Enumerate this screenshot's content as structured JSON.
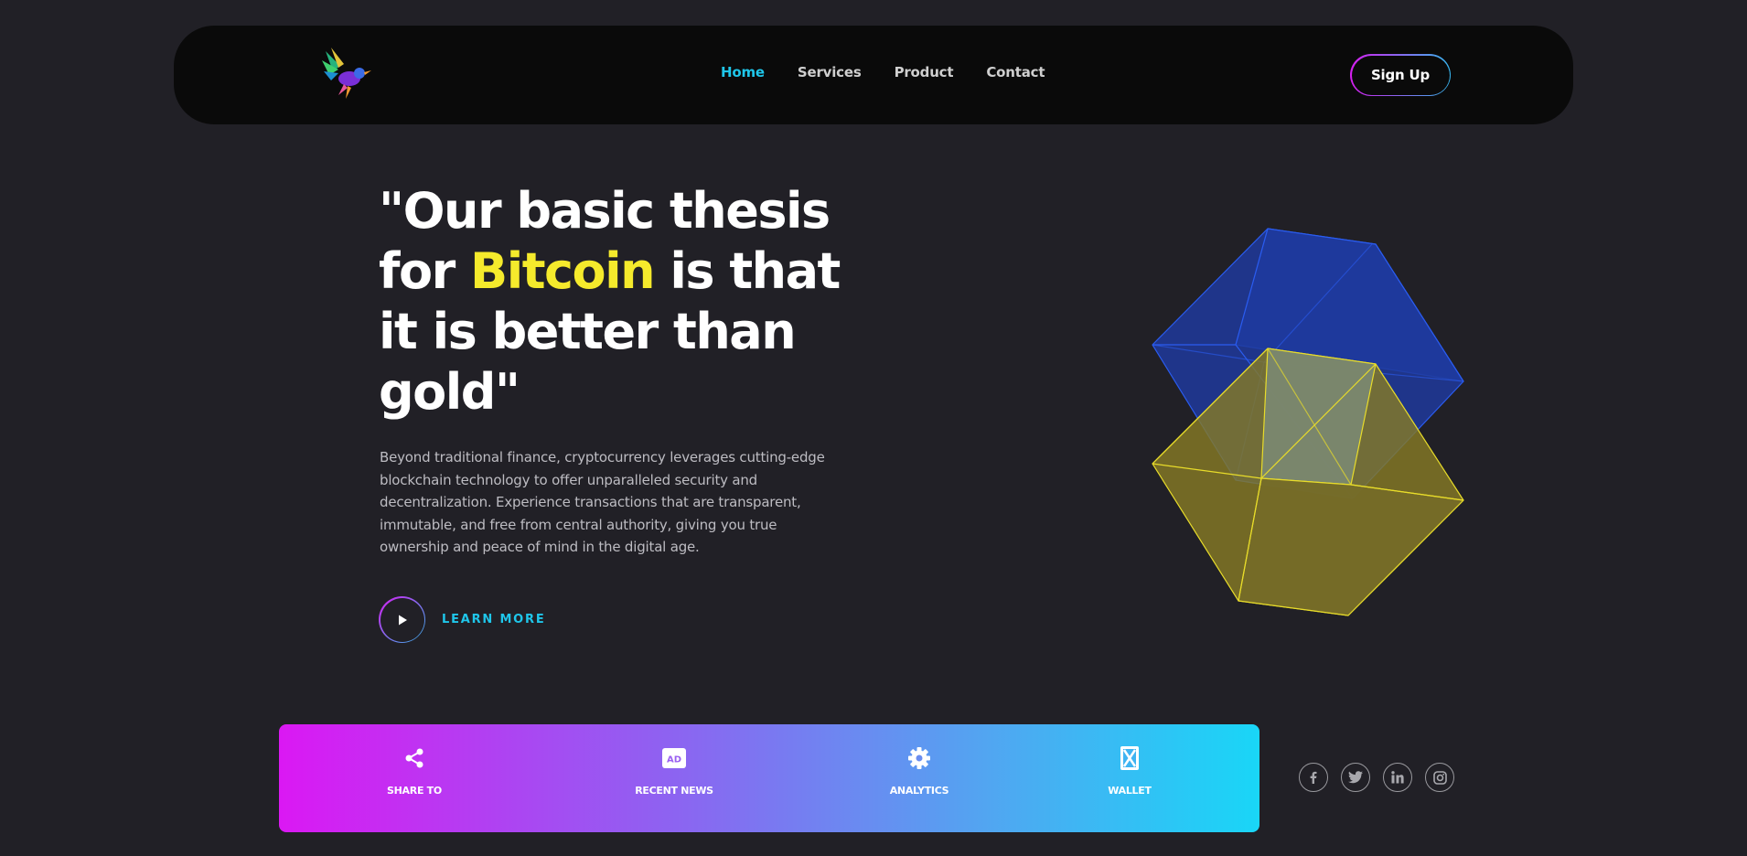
{
  "nav": {
    "links": [
      {
        "label": "Home",
        "active": true
      },
      {
        "label": "Services",
        "active": false
      },
      {
        "label": "Product",
        "active": false
      },
      {
        "label": "Contact",
        "active": false
      }
    ],
    "signup_label": "Sign Up",
    "logo_icon": "hummingbird-logo-icon"
  },
  "hero": {
    "headline_part1": "\"Our basic thesis for ",
    "headline_accent": "Bitcoin",
    "headline_part2": " is that it is better than gold\"",
    "description": "Beyond traditional finance, cryptocurrency leverages cutting-edge blockchain technology to offer unparalleled security and decentralization. Experience transactions that are transparent, immutable, and free from central authority, giving you true ownership and peace of mind in the digital age.",
    "cta_label": "LEARN MORE"
  },
  "features": [
    {
      "label": "SHARE TO",
      "icon": "share-icon"
    },
    {
      "label": "RECENT NEWS",
      "icon": "ad-icon"
    },
    {
      "label": "ANALYTICS",
      "icon": "gear-icon"
    },
    {
      "label": "WALLET",
      "icon": "wallet-icon"
    }
  ],
  "socials": [
    "facebook-icon",
    "twitter-icon",
    "linkedin-icon",
    "instagram-icon"
  ],
  "colors": {
    "background": "#212026",
    "navbar": "#0a0a0a",
    "accent_cyan": "#1fc6ea",
    "accent_yellow": "#f5ea2c",
    "gradient_start": "#db18f3",
    "gradient_end": "#19d6f7",
    "cube_blue": "#1e3a9c",
    "cube_yellow": "#7a7030"
  }
}
